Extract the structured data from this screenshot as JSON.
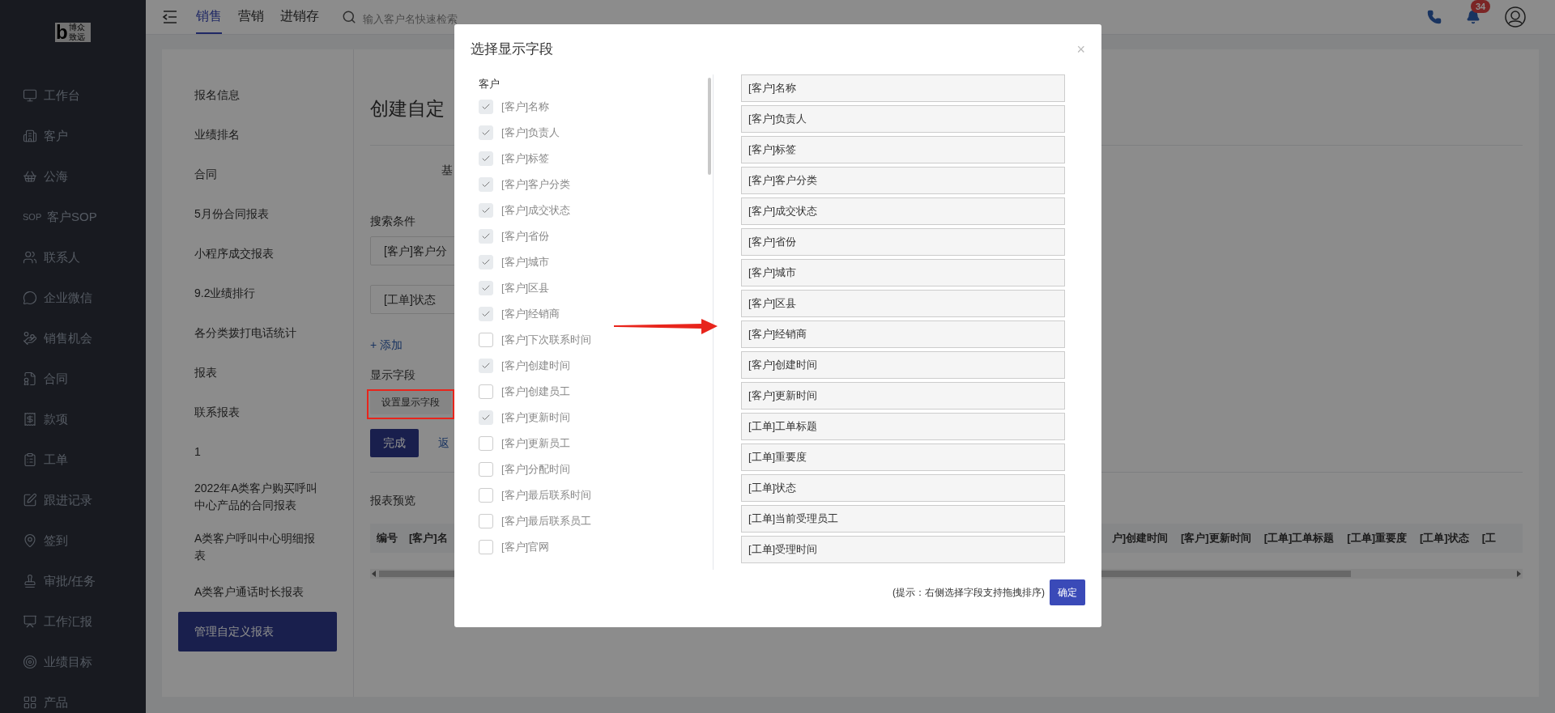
{
  "logo": {
    "mark": "b",
    "lines": [
      "博众",
      "致远"
    ]
  },
  "sidebar": {
    "items": [
      {
        "label": "工作台"
      },
      {
        "label": "客户"
      },
      {
        "label": "公海"
      },
      {
        "label": "客户SOP",
        "icon_text": "SOP"
      },
      {
        "label": "联系人"
      },
      {
        "label": "企业微信"
      },
      {
        "label": "销售机会"
      },
      {
        "label": "合同"
      },
      {
        "label": "款项"
      },
      {
        "label": "工单"
      },
      {
        "label": "跟进记录"
      },
      {
        "label": "签到"
      },
      {
        "label": "审批/任务"
      },
      {
        "label": "工作汇报"
      },
      {
        "label": "业绩目标"
      },
      {
        "label": "产品"
      }
    ]
  },
  "topbar": {
    "tabs": [
      {
        "label": "销售",
        "selected": true
      },
      {
        "label": "营销",
        "selected": false
      },
      {
        "label": "进销存",
        "selected": false
      }
    ],
    "search": {
      "placeholder": "输入客户名快速检索"
    },
    "notifications": "34"
  },
  "report_list": {
    "items": [
      {
        "label": "报名信息",
        "selected": false
      },
      {
        "label": "业绩排名",
        "selected": false
      },
      {
        "label": "合同",
        "selected": false
      },
      {
        "label": "5月份合同报表",
        "selected": false
      },
      {
        "label": "小程序成交报表",
        "selected": false
      },
      {
        "label": "9.2业绩排行",
        "selected": false
      },
      {
        "label": "各分类拨打电话统计",
        "selected": false
      },
      {
        "label": "报表",
        "selected": false
      },
      {
        "label": "联系报表",
        "selected": false
      },
      {
        "label": "1",
        "selected": false
      },
      {
        "label": "2022年A类客户购买呼叫中心产品的合同报表",
        "selected": false
      },
      {
        "label": "A类客户呼叫中心明细报表",
        "selected": false
      },
      {
        "label": "A类客户通话时长报表",
        "selected": false
      },
      {
        "label": "管理自定义报表",
        "selected": true
      }
    ]
  },
  "editor": {
    "title": "创建自定",
    "tab_1": "基",
    "search_label": "搜索条件",
    "conditions": [
      "[客户]客户分",
      "[工单]状态"
    ],
    "add_link": "+ 添加",
    "fields_label": "显示字段",
    "set_fields_button": "设置显示字段",
    "done_button": "完成",
    "back_link": "返",
    "preview_title": "报表预览",
    "table": {
      "columns_left": [
        "编号",
        "[客户]名"
      ],
      "columns_right": [
        "户]创建时间",
        "[客户]更新时间",
        "[工单]工单标题",
        "[工单]重要度",
        "[工单]状态",
        "[工"
      ]
    }
  },
  "dialog": {
    "title": "选择显示字段",
    "close": "×",
    "group": "客户",
    "fields": [
      {
        "label": "[客户]名称",
        "checked": true
      },
      {
        "label": "[客户]负责人",
        "checked": true
      },
      {
        "label": "[客户]标签",
        "checked": true
      },
      {
        "label": "[客户]客户分类",
        "checked": true
      },
      {
        "label": "[客户]成交状态",
        "checked": true
      },
      {
        "label": "[客户]省份",
        "checked": true
      },
      {
        "label": "[客户]城市",
        "checked": true
      },
      {
        "label": "[客户]区县",
        "checked": true
      },
      {
        "label": "[客户]经销商",
        "checked": true
      },
      {
        "label": "[客户]下次联系时间",
        "checked": false
      },
      {
        "label": "[客户]创建时间",
        "checked": true
      },
      {
        "label": "[客户]创建员工",
        "checked": false
      },
      {
        "label": "[客户]更新时间",
        "checked": true
      },
      {
        "label": "[客户]更新员工",
        "checked": false
      },
      {
        "label": "[客户]分配时间",
        "checked": false
      },
      {
        "label": "[客户]最后联系时间",
        "checked": false
      },
      {
        "label": "[客户]最后联系员工",
        "checked": false
      },
      {
        "label": "[客户]官网",
        "checked": false
      }
    ],
    "selected_fields": [
      "[客户]名称",
      "[客户]负责人",
      "[客户]标签",
      "[客户]客户分类",
      "[客户]成交状态",
      "[客户]省份",
      "[客户]城市",
      "[客户]区县",
      "[客户]经销商",
      "[客户]创建时间",
      "[客户]更新时间",
      "[工单]工单标题",
      "[工单]重要度",
      "[工单]状态",
      "[工单]当前受理员工",
      "[工单]受理时间"
    ],
    "hint": "(提示：右侧选择字段支持拖拽排序)",
    "confirm_button": "确定"
  }
}
